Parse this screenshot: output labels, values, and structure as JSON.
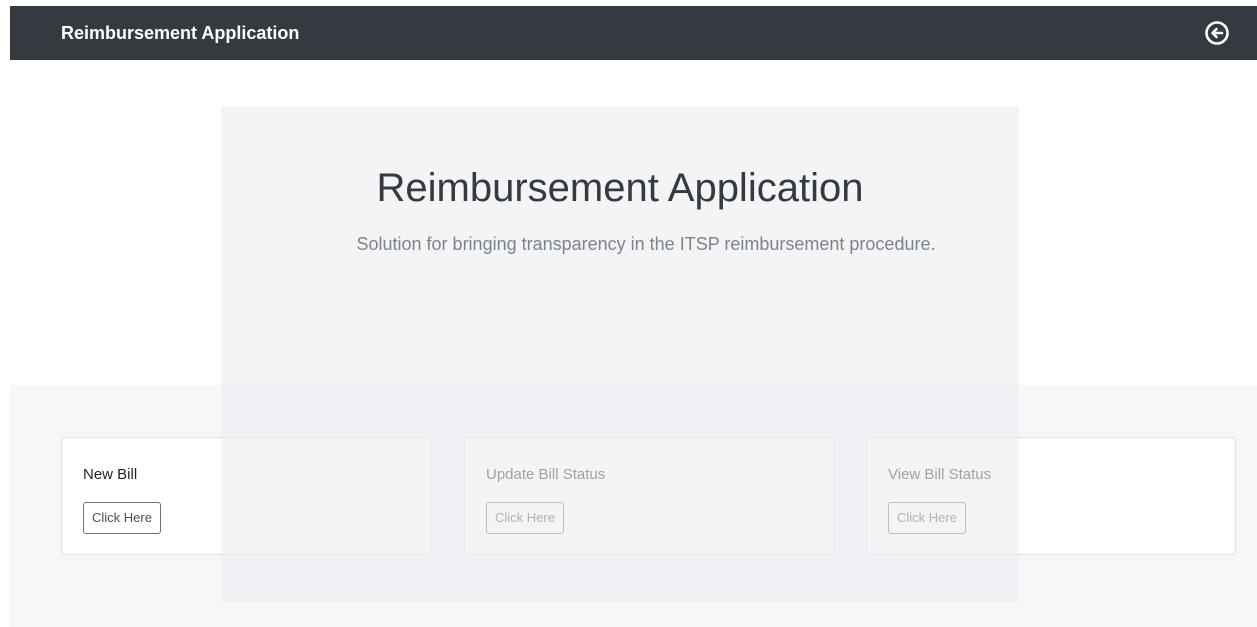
{
  "navbar": {
    "brand": "Reimbursement Application",
    "logout_icon": "arrow-circle-left-icon"
  },
  "hero": {
    "title": "Reimbursement Application",
    "lead": "Solution for bringing transparency in the ITSP reimbursement procedure."
  },
  "cards": [
    {
      "title": "New Bill",
      "button_label": "Click Here"
    },
    {
      "title": "Update Bill Status",
      "button_label": "Click Here"
    },
    {
      "title": "View Bill Status",
      "button_label": "Click Here"
    }
  ],
  "colors": {
    "navbar_bg": "#343a40",
    "navbar_text": "#ffffff",
    "jumbotron_bg": "#ecedef",
    "band_bg": "#f5f7f9",
    "card_border": "#dee2e6",
    "button_border": "#6c757d"
  }
}
